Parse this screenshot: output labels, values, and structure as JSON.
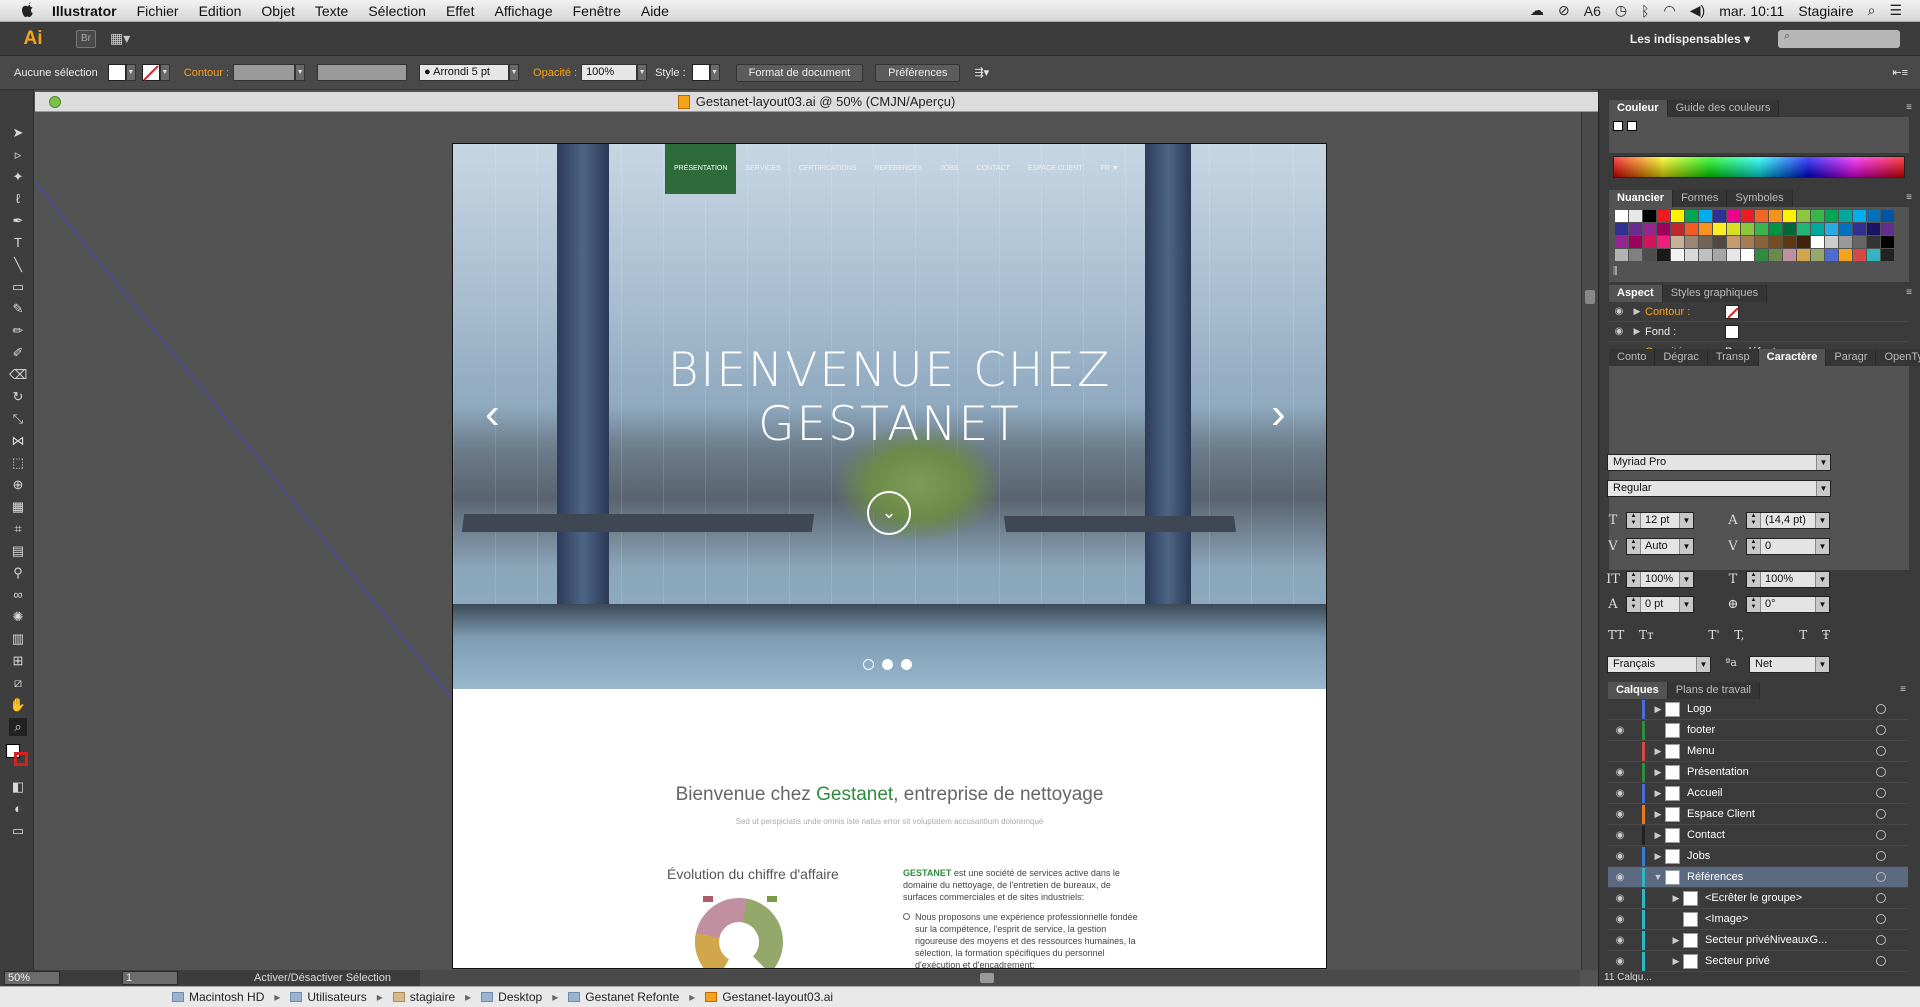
{
  "menubar": {
    "items": [
      "Illustrator",
      "Fichier",
      "Edition",
      "Objet",
      "Texte",
      "Sélection",
      "Effet",
      "Affichage",
      "Fenêtre",
      "Aide"
    ],
    "clock": "mar. 10:11",
    "user": "Stagiaire",
    "adobe_badge": "6"
  },
  "appbar": {
    "logo": "Ai",
    "bridge": "Br",
    "workspace": "Les indispensables"
  },
  "control": {
    "selection": "Aucune sélection",
    "stroke_label": "Contour :",
    "brush": "Arrondi 5 pt",
    "opacity_label": "Opacité :",
    "opacity_value": "100%",
    "style_label": "Style :",
    "doc_format": "Format de document",
    "preferences": "Préférences"
  },
  "document": {
    "tab_title": "Gestanet-layout03.ai @ 50% (CMJN/Aperçu)"
  },
  "website": {
    "nav": [
      "PRÉSENTATION",
      "SERVICES",
      "CERTIFICATIONS",
      "REFERENCES",
      "JOBS",
      "CONTACT",
      "ESPACE CLIENT",
      "FR ▼"
    ],
    "headline_1": "BIENVENUE CHEZ",
    "headline_2": "GESTANET",
    "welcome_prefix": "Bienvenue chez ",
    "welcome_brand": "Gestanet",
    "welcome_suffix": ", entreprise de nettoyage",
    "subtitle": "Sed ut perspiciatis unde omnis iste natus error sit voluptatem accusantium doloremque",
    "chart_title": "Évolution du chiffre d'affaire",
    "company_brand": "GESTANET",
    "company_text": " est une société de services active dans le domaine du nettoyage, de l'entretien de bureaux, de surfaces commerciales et de sites industriels:",
    "bullet": "Nous proposons une expérience professionnelle fondée sur la compétence, l'esprit de service, la gestion rigoureuse des moyens et des ressources humaines, la sélection, la formation spécifiques du personnel d'exécution et d'encadrement;"
  },
  "panels": {
    "couleur_tabs": [
      "Couleur",
      "Guide des couleurs"
    ],
    "nuancier_tabs": [
      "Nuancier",
      "Formes",
      "Symboles"
    ],
    "aspect_tabs": [
      "Aspect",
      "Styles graphiques"
    ],
    "aspect_rows": [
      {
        "label": "Contour :"
      },
      {
        "label": "Fond :"
      },
      {
        "label": "Opacité :",
        "value": "Par défaut"
      }
    ],
    "char_tabs": [
      "Conto",
      "Dégrac",
      "Transp",
      "Caractère",
      "Paragr",
      "OpenTy"
    ],
    "font_family": "Myriad Pro",
    "font_style": "Regular",
    "font_size": "12 pt",
    "leading": "(14,4 pt)",
    "kerning": "Auto",
    "tracking": "0",
    "vscale": "100%",
    "hscale": "100%",
    "baseline": "0 pt",
    "rotation": "0°",
    "language": "Français",
    "aa": "Net",
    "layers_tabs": [
      "Calques",
      "Plans de travail"
    ],
    "layers": [
      {
        "name": "Logo",
        "eye": false,
        "color": "#4a6cd4",
        "expand": true,
        "indent": 0
      },
      {
        "name": "footer",
        "eye": true,
        "color": "#2e8c3f",
        "expand": false,
        "indent": 0
      },
      {
        "name": "Menu",
        "eye": false,
        "color": "#d44a4a",
        "expand": true,
        "indent": 0
      },
      {
        "name": "Présentation",
        "eye": true,
        "color": "#2e8c3f",
        "expand": true,
        "indent": 0
      },
      {
        "name": "Accueil",
        "eye": true,
        "color": "#4a6cd4",
        "expand": true,
        "indent": 0
      },
      {
        "name": "Espace Client",
        "eye": true,
        "color": "#e47b24",
        "expand": true,
        "indent": 0
      },
      {
        "name": "Contact",
        "eye": true,
        "color": "#222222",
        "expand": true,
        "indent": 0
      },
      {
        "name": "Jobs",
        "eye": true,
        "color": "#3a7ad4",
        "expand": true,
        "indent": 0
      },
      {
        "name": "Références",
        "eye": true,
        "color": "#2fb6c4",
        "expand": true,
        "indent": 0,
        "open": true,
        "selected": true
      },
      {
        "name": "<Ecrêter le groupe>",
        "eye": true,
        "color": "#2fb6c4",
        "expand": true,
        "indent": 1
      },
      {
        "name": "<Image>",
        "eye": true,
        "color": "#2fb6c4",
        "expand": false,
        "indent": 1
      },
      {
        "name": "Secteur privéNiveauxG...",
        "eye": true,
        "color": "#2fb6c4",
        "expand": true,
        "indent": 1
      },
      {
        "name": "Secteur privé",
        "eye": true,
        "color": "#2fb6c4",
        "expand": true,
        "indent": 1
      }
    ],
    "layers_count": "11 Calqu..."
  },
  "status": {
    "zoom": "50%",
    "page": "1",
    "tool_status": "Activer/Désactiver Sélection"
  },
  "path": [
    "Macintosh HD",
    "Utilisateurs",
    "stagiaire",
    "Desktop",
    "Gestanet Refonte",
    "Gestanet-layout03.ai"
  ],
  "colors": {
    "brand_green": "#2e8c3f",
    "accent_orange": "#f7a21b"
  }
}
